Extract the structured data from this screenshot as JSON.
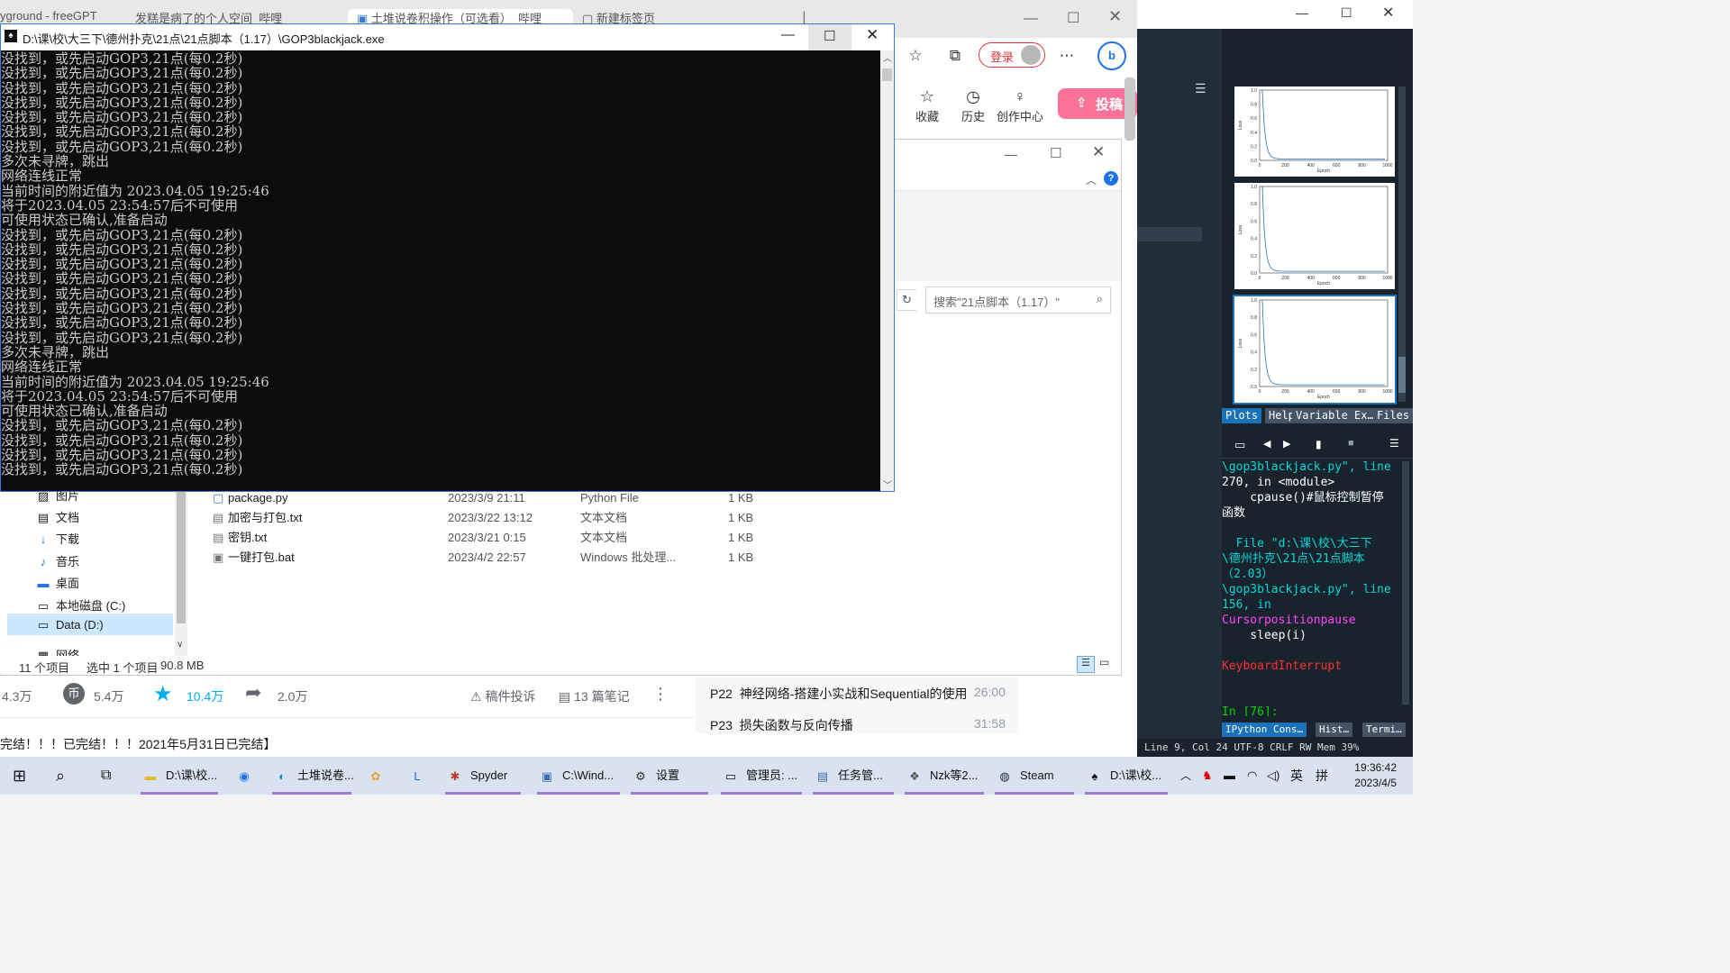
{
  "browser": {
    "tabs": [
      "yground - freeGPT",
      "发糕是病了的个人空间_哔哩",
      "土堆说卷积操作（可选看）_哔哩",
      "新建标签页"
    ],
    "login_label": "登录",
    "nav": [
      {
        "icon": "star-icon",
        "label": "收藏"
      },
      {
        "icon": "clock-icon",
        "label": "历史"
      },
      {
        "icon": "bulb-icon",
        "label": "创作中心"
      }
    ],
    "upload_label": "投稿"
  },
  "video": {
    "stats": {
      "views": "4.3万",
      "coins": "5.4万",
      "favorites": "10.4万",
      "shares": "2.0万",
      "report": "稿件投诉",
      "notes": "13 篇笔记"
    },
    "desc": "完结！！！已完结！！！2021年5月31日已完结】",
    "playlist": [
      {
        "index": "P22",
        "title": "神经网络-搭建小实战和Sequential的使用",
        "duration": "26:00"
      },
      {
        "index": "P23",
        "title": "损失函数与反向传播",
        "duration": "31:58"
      }
    ]
  },
  "explorer": {
    "search_placeholder": "搜索\"21点脚本（1.17）\"",
    "nav_items": [
      {
        "icon": "picture-icon",
        "label": "图片"
      },
      {
        "icon": "document-icon",
        "label": "文档"
      },
      {
        "icon": "download-icon",
        "label": "下载"
      },
      {
        "icon": "music-icon",
        "label": "音乐"
      },
      {
        "icon": "desktop-icon",
        "label": "桌面"
      },
      {
        "icon": "disk-icon",
        "label": "本地磁盘 (C:)"
      },
      {
        "icon": "disk-icon",
        "label": "Data (D:)"
      },
      {
        "icon": "network-icon",
        "label": "网络"
      }
    ],
    "files": [
      {
        "name": "package.py",
        "date": "2023/3/9 21:11",
        "type": "Python File",
        "size": "1 KB"
      },
      {
        "name": "加密与打包.txt",
        "date": "2023/3/22 13:12",
        "type": "文本文档",
        "size": "1 KB"
      },
      {
        "name": "密钥.txt",
        "date": "2023/3/21 0:15",
        "type": "文本文档",
        "size": "1 KB"
      },
      {
        "name": "一键打包.bat",
        "date": "2023/4/2 22:57",
        "type": "Windows 批处理...",
        "size": "1 KB"
      }
    ],
    "status": {
      "count": "11 个项目",
      "selected": "选中 1 个项目",
      "selected_size": "90.8 MB"
    }
  },
  "console": {
    "title": "D:\\课\\校\\大三下\\德州扑克\\21点\\21点脚本（1.17）\\GOP3blackjack.exe",
    "lines": [
      "没找到，或先启动GOP3,21点(每0.2秒)",
      "没找到，或先启动GOP3,21点(每0.2秒)",
      "没找到，或先启动GOP3,21点(每0.2秒)",
      "没找到，或先启动GOP3,21点(每0.2秒)",
      "没找到，或先启动GOP3,21点(每0.2秒)",
      "没找到，或先启动GOP3,21点(每0.2秒)",
      "没找到，或先启动GOP3,21点(每0.2秒)",
      "多次未寻牌，跳出",
      "网络连线正常",
      "当前时间的附近值为 2023.04.05 19:25:46",
      "将于2023.04.05 23:54:57后不可使用",
      "可使用状态已确认,准备启动",
      "没找到，或先启动GOP3,21点(每0.2秒)",
      "没找到，或先启动GOP3,21点(每0.2秒)",
      "没找到，或先启动GOP3,21点(每0.2秒)",
      "没找到，或先启动GOP3,21点(每0.2秒)",
      "没找到，或先启动GOP3,21点(每0.2秒)",
      "没找到，或先启动GOP3,21点(每0.2秒)",
      "没找到，或先启动GOP3,21点(每0.2秒)",
      "没找到，或先启动GOP3,21点(每0.2秒)",
      "多次未寻牌，跳出",
      "网络连线正常",
      "当前时间的附近值为 2023.04.05 19:25:46",
      "将于2023.04.05 23:54:57后不可使用",
      "可使用状态已确认,准备启动",
      "没找到，或先启动GOP3,21点(每0.2秒)",
      "没找到，或先启动GOP3,21点(每0.2秒)",
      "没找到，或先启动GOP3,21点(每0.2秒)",
      "没找到，或先启动GOP3,21点(每0.2秒)"
    ]
  },
  "spyder": {
    "plot_tabs": [
      "Plots",
      "Help",
      "Variable Ex…",
      "Files"
    ],
    "plot_axis": {
      "xlabel": "Epoch",
      "ylabel": "Loss",
      "xticks": [
        "0",
        "200",
        "400",
        "600",
        "800",
        "1000"
      ],
      "yticks": [
        "0.0",
        "0.2",
        "0.4",
        "0.6",
        "0.8",
        "1.0"
      ]
    },
    "console_lines": [
      {
        "text": "\\gop3blackjack.py\", line",
        "color": "#00d7d7"
      },
      {
        "text": "270, in <module>",
        "color": "#ffffff"
      },
      {
        "text": "    cpause()#鼠标控制暂停",
        "color": "#ffffff"
      },
      {
        "text": "函数",
        "color": "#ffffff"
      },
      {
        "text": "",
        "color": "#ffffff"
      },
      {
        "text": "  File \"d:\\课\\校\\大三下",
        "color": "#00d7d7"
      },
      {
        "text": "\\德州扑克\\21点\\21点脚本",
        "color": "#00d7d7"
      },
      {
        "text": "（2.03）",
        "color": "#00d7d7"
      },
      {
        "text": "\\gop3blackjack.py\", line",
        "color": "#00d7d7"
      },
      {
        "text": "156, in",
        "color": "#00d7d7"
      },
      {
        "text": "Cursorpositionpause",
        "color": "#ff44ff"
      },
      {
        "text": "    sleep(i)",
        "color": "#ffffff"
      },
      {
        "text": "",
        "color": "#ffffff"
      },
      {
        "text": "KeyboardInterrupt",
        "color": "#ff3030"
      },
      {
        "text": "",
        "color": "#ffffff"
      },
      {
        "text": "",
        "color": "#ffffff"
      },
      {
        "text": "In [76]:",
        "color": "#00d700"
      }
    ],
    "console_tabs": [
      "IPython Cons…",
      "Hist…",
      "Termi…"
    ],
    "status": "Line 9, Col 24  UTF-8  CRLF  RW   Mem 39%"
  },
  "taskbar": {
    "apps": [
      {
        "icon": "folder-icon",
        "label": "D:\\课\\校..."
      },
      {
        "icon": "chrome-icon",
        "label": ""
      },
      {
        "icon": "edge-icon",
        "label": "土堆说卷..."
      },
      {
        "icon": "paint-icon",
        "label": ""
      },
      {
        "icon": "l-app-icon",
        "label": ""
      },
      {
        "icon": "spyder-icon",
        "label": "Spyder"
      },
      {
        "icon": "window-icon",
        "label": "C:\\Wind..."
      },
      {
        "icon": "settings-icon",
        "label": "设置"
      },
      {
        "icon": "terminal-icon",
        "label": "管理员: ..."
      },
      {
        "icon": "taskmgr-icon",
        "label": "任务管..."
      },
      {
        "icon": "figure-icon",
        "label": "Nzk等2..."
      },
      {
        "icon": "steam-icon",
        "label": "Steam"
      },
      {
        "icon": "exe-icon",
        "label": "D:\\课\\校..."
      }
    ],
    "ime": "英",
    "ime2": "拼",
    "time": "19:36:42",
    "date": "2023/4/5"
  }
}
